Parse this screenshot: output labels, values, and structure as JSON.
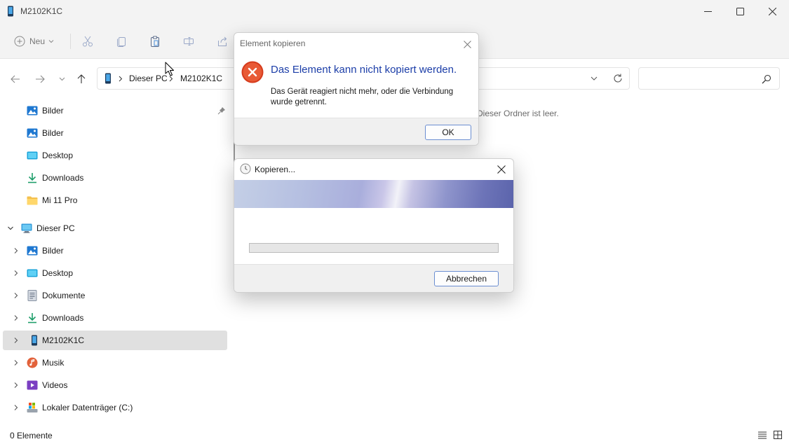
{
  "window": {
    "title": "M2102K1C"
  },
  "toolbar": {
    "new_label": "Neu"
  },
  "address": {
    "crumbs": [
      "Dieser PC",
      "M2102K1C"
    ],
    "search_placeholder": ""
  },
  "sidebar": {
    "quick_access": [
      {
        "label": "Bilder",
        "icon": "pictures-icon",
        "pinned": true
      },
      {
        "label": "Bilder",
        "icon": "pictures-icon"
      },
      {
        "label": "Desktop",
        "icon": "desktop-icon"
      },
      {
        "label": "Downloads",
        "icon": "downloads-icon"
      },
      {
        "label": "Mi 11 Pro",
        "icon": "folder-icon"
      }
    ],
    "this_pc": {
      "label": "Dieser PC",
      "children": [
        {
          "label": "Bilder",
          "icon": "pictures-icon"
        },
        {
          "label": "Desktop",
          "icon": "desktop-icon"
        },
        {
          "label": "Dokumente",
          "icon": "documents-icon"
        },
        {
          "label": "Downloads",
          "icon": "downloads-icon"
        },
        {
          "label": "M2102K1C",
          "icon": "phone-icon",
          "selected": true
        },
        {
          "label": "Musik",
          "icon": "music-icon"
        },
        {
          "label": "Videos",
          "icon": "videos-icon"
        },
        {
          "label": "Lokaler Datenträger (C:)",
          "icon": "drive-icon"
        }
      ]
    }
  },
  "content": {
    "empty_message": "Dieser Ordner ist leer."
  },
  "status": {
    "item_count": "0 Elemente"
  },
  "error_dialog": {
    "title": "Element kopieren",
    "heading": "Das Element kann nicht kopiert werden.",
    "message": "Das Gerät reagiert nicht mehr, oder die Verbindung wurde getrennt.",
    "ok_label": "OK"
  },
  "copy_dialog": {
    "title": "Kopieren...",
    "progress": 0,
    "cancel_label": "Abbrechen"
  },
  "colors": {
    "accent": "#1c3ea8",
    "error": "#d83b01",
    "selection": "#e0e0e0",
    "progress_fill": "#06b025"
  }
}
